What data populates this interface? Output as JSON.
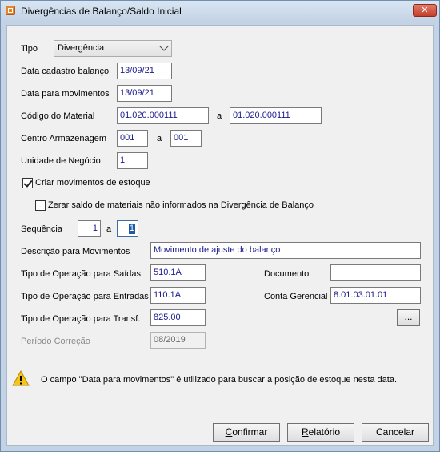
{
  "window": {
    "title": "Divergências de Balanço/Saldo Inicial",
    "close_glyph": "✕"
  },
  "form": {
    "tipo": {
      "label": "Tipo",
      "value": "Divergência"
    },
    "data_cadastro": {
      "label": "Data cadastro balanço",
      "value": "13/09/21"
    },
    "data_movimentos": {
      "label": "Data para movimentos",
      "value": "13/09/21"
    },
    "codigo_material": {
      "label": "Código do Material",
      "from": "01.020.000111",
      "sep": "a",
      "to": "01.020.000111"
    },
    "centro_armazenagem": {
      "label": "Centro Armazenagem",
      "from": "001",
      "sep": "a",
      "to": "001"
    },
    "unidade_negocio": {
      "label": "Unidade de Negócio",
      "value": "1"
    },
    "criar_movimentos": {
      "label": "Criar movimentos de estoque",
      "checked": true
    },
    "zerar_saldo": {
      "label": "Zerar saldo de materiais não informados na Divergência de Balanço",
      "checked": false
    },
    "sequencia": {
      "label": "Sequência",
      "from": "1",
      "sep": "a",
      "to": "1"
    },
    "descricao": {
      "label": "Descrição para Movimentos",
      "value": "Movimento de ajuste do balanço"
    },
    "tipo_op_saidas": {
      "label": "Tipo de Operação para Saídas",
      "value": "510.1A"
    },
    "documento": {
      "label": "Documento",
      "value": ""
    },
    "tipo_op_entradas": {
      "label": "Tipo de Operação para Entradas",
      "value": "110.1A"
    },
    "conta_gerencial": {
      "label": "Conta Gerencial",
      "value": "8.01.03.01.01"
    },
    "tipo_op_transf": {
      "label": "Tipo de Operação para Transf.",
      "value": "825.00"
    },
    "browse_button": "...",
    "periodo_correcao": {
      "label": "Período Correção",
      "value": "08/2019"
    }
  },
  "message": "O campo \"Data para movimentos\" é utilizado para buscar a posição de estoque nesta data.",
  "buttons": {
    "confirmar": {
      "mnemonic": "C",
      "rest": "onfirmar"
    },
    "relatorio": {
      "mnemonic": "R",
      "rest": "elatório"
    },
    "cancelar": {
      "mnemonic": "",
      "rest": "Cancelar"
    }
  },
  "colors": {
    "value_text": "#1a1a8c",
    "warning": "#f5c518",
    "title_bar": "#c3d3e5"
  }
}
